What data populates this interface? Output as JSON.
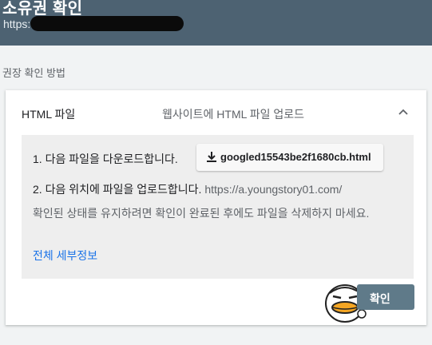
{
  "header": {
    "title": "소유권 확인",
    "url_prefix": "https:"
  },
  "section_label": "권장 확인 방법",
  "method": {
    "name": "HTML 파일",
    "description": "웹사이트에 HTML 파일 업로드",
    "expand_icon": "chevron-up-icon"
  },
  "steps": {
    "step1_text": "1. 다음 파일을 다운로드합니다.",
    "download_file": "googled15543be2f1680cb.html",
    "download_icon": "download-icon",
    "step2_text": "2. 다음 위치에 파일을 업로드합니다.",
    "step2_site": "https://a.youngstory01.com/",
    "warning": "확인된 상태를 유지하려면 확인이 완료된 후에도 파일을 삭제하지 마세요.",
    "details_link": "전체 세부정보"
  },
  "confirm_label": "확인",
  "colors": {
    "header_bg": "#4d6272",
    "link": "#1a73e8",
    "confirm_bg": "#5f7a89"
  }
}
